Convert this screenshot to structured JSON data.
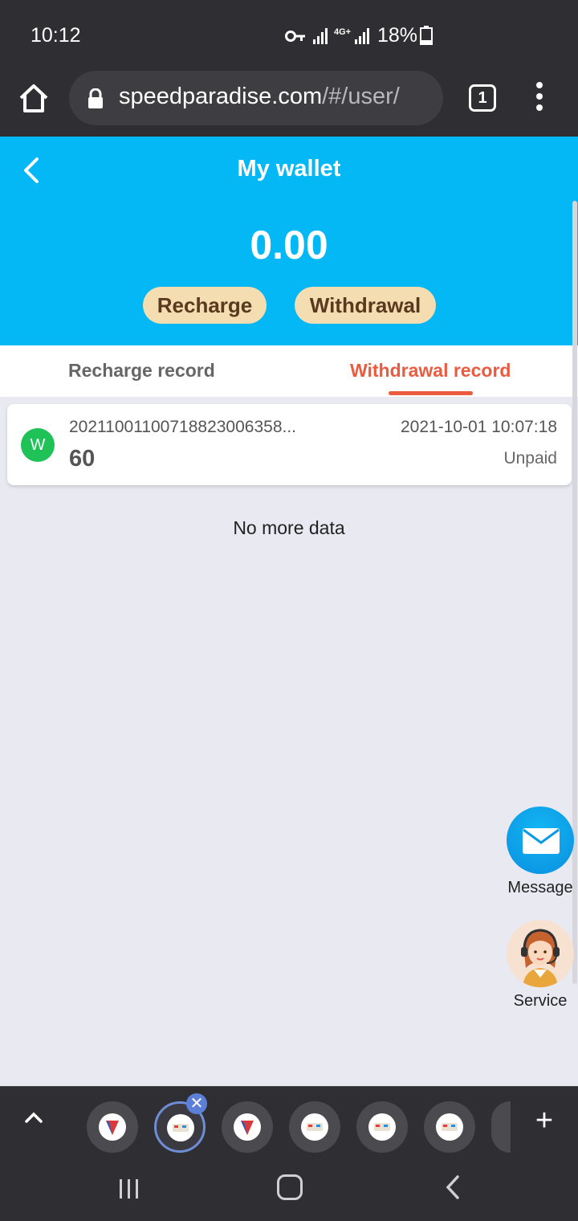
{
  "status_bar": {
    "time": "10:12",
    "network": "4G+",
    "battery": "18%"
  },
  "browser": {
    "url_domain": "speedparadise.com",
    "url_path": "/#/user/",
    "tab_count": "1"
  },
  "wallet": {
    "title": "My wallet",
    "balance": "0.00",
    "recharge_label": "Recharge",
    "withdrawal_label": "Withdrawal"
  },
  "tabs": {
    "recharge_record": "Recharge record",
    "withdrawal_record": "Withdrawal record",
    "active": "withdrawal_record"
  },
  "records": [
    {
      "badge": "W",
      "id": "20211001100718823006358...",
      "date": "2021-10-01 10:07:18",
      "amount": "60",
      "status": "Unpaid"
    }
  ],
  "list_footer": "No more data",
  "floating": {
    "message_label": "Message",
    "service_label": "Service"
  },
  "bottom_tabs": {
    "add_label": "+",
    "close_label": "✕"
  },
  "colors": {
    "header_bg": "#03b8f4",
    "pill_bg": "#f3ddb1",
    "active_tab": "#ea5b3f",
    "badge_green": "#1fc257"
  }
}
